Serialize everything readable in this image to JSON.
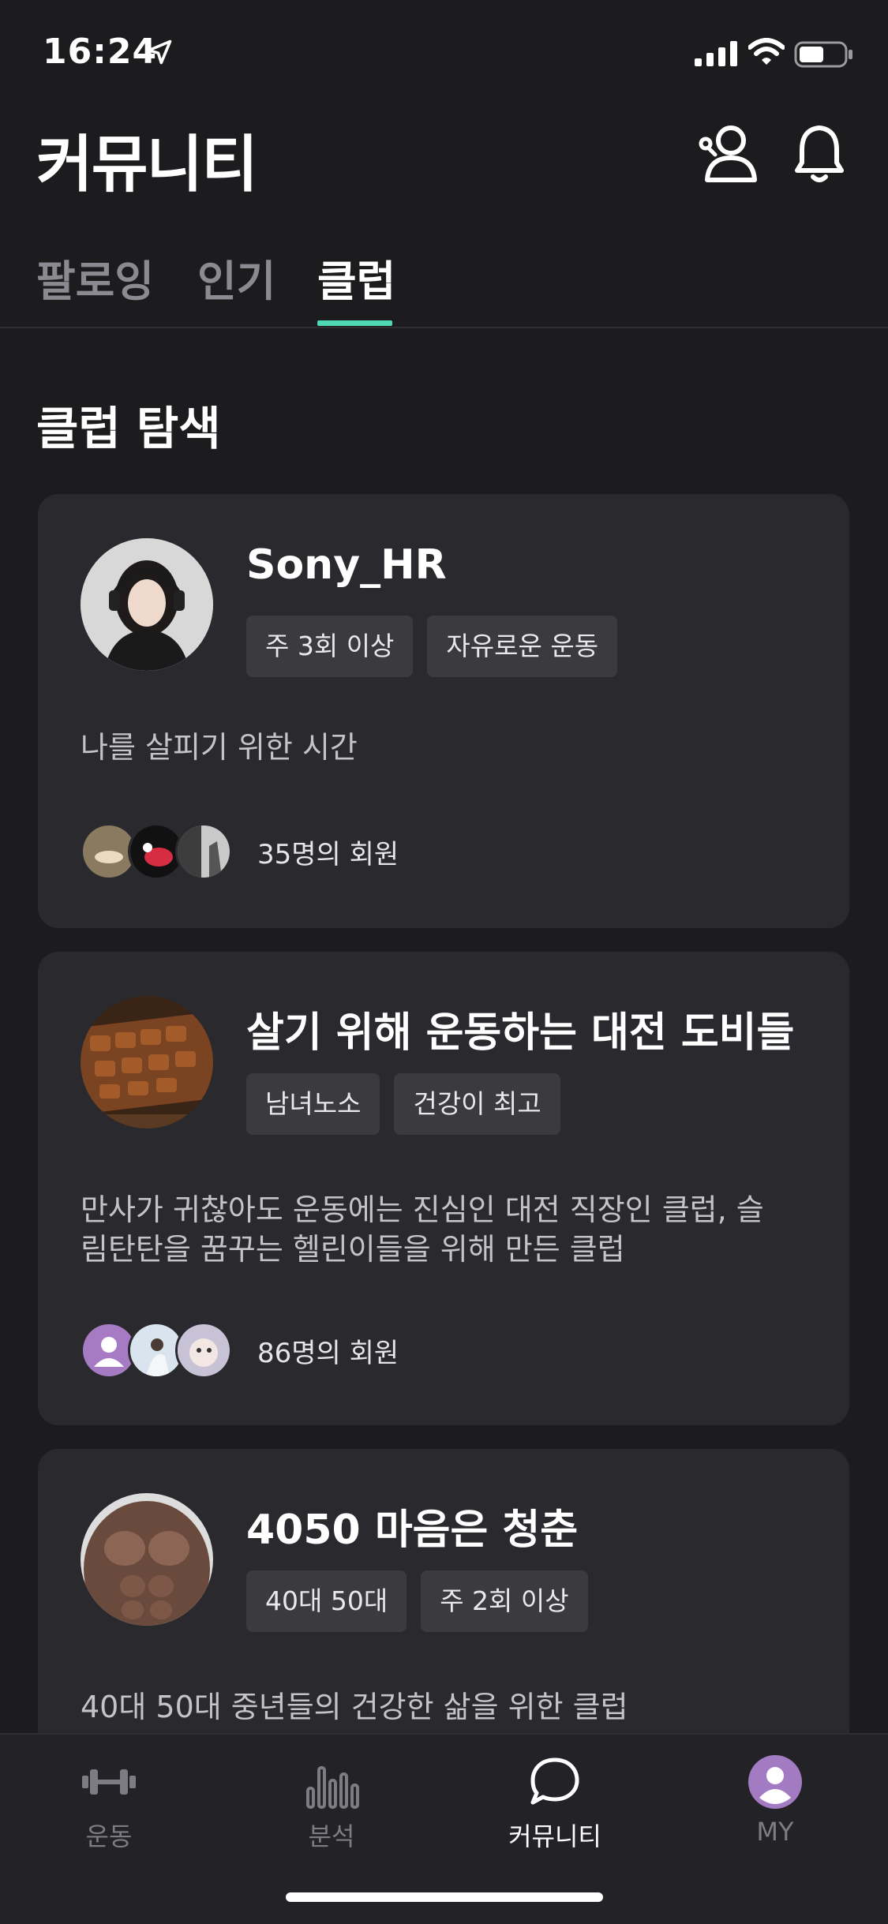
{
  "status": {
    "time": "16:24"
  },
  "header": {
    "title": "커뮤니티",
    "profile_icon": "person-add-icon",
    "bell_icon": "bell-icon"
  },
  "tabs": [
    {
      "label": "팔로잉",
      "active": false
    },
    {
      "label": "인기",
      "active": false
    },
    {
      "label": "클럽",
      "active": true
    }
  ],
  "accent_color": "#4fd8b3",
  "section": {
    "title": "클럽 탐색"
  },
  "clubs": [
    {
      "name": "Sony_HR",
      "tags": [
        "주 3회 이상",
        "자유로운 운동"
      ],
      "description": "나를 살피기 위한 시간",
      "members": "35명의 회원"
    },
    {
      "name": "살기 위해 운동하는 대전 도비들",
      "tags": [
        "남녀노소",
        "건강이 최고"
      ],
      "description_line1": "만사가 귀찮아도 운동에는 진심인 대전 직장인 클럽, 슬",
      "description_line2": "림탄탄을 꿈꾸는 헬린이들을 위해 만든 클럽",
      "members": "86명의 회원"
    },
    {
      "name": "4050 마음은 청춘",
      "tags": [
        "40대 50대",
        "주 2회 이상"
      ],
      "description": "40대 50대 중년들의 건강한 삶을 위한 클럽"
    }
  ],
  "bottom_nav": [
    {
      "label": "운동",
      "icon": "dumbbell-icon"
    },
    {
      "label": "분석",
      "icon": "bar-chart-icon"
    },
    {
      "label": "커뮤니티",
      "icon": "chat-bubble-icon",
      "active": true
    },
    {
      "label": "MY",
      "icon": "user-avatar-icon"
    }
  ]
}
